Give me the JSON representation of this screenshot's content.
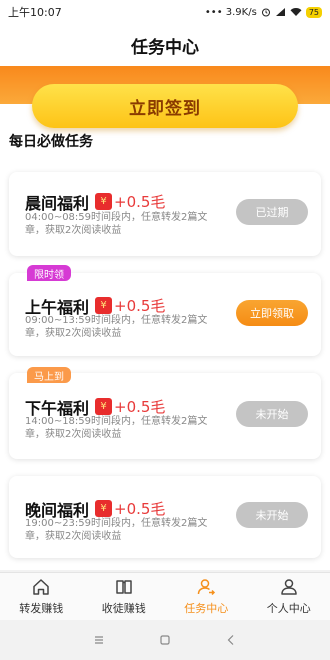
{
  "status": {
    "time": "上午10:07",
    "network": "••• 3.9K/s",
    "battery": "75"
  },
  "title": "任务中心",
  "signin": {
    "label": "立即签到"
  },
  "section_title": "每日必做任务",
  "tasks": [
    {
      "name": "晨间福利",
      "yen": "¥",
      "reward": "+0.5毛",
      "desc": "04:00~08:59时间段内，任意转发2篇文章，获取2次阅读收益",
      "button": "已过期",
      "tag": ""
    },
    {
      "name": "上午福利",
      "yen": "¥",
      "reward": "+0.5毛",
      "desc": "09:00~13:59时间段内，任意转发2篇文章，获取2次阅读收益",
      "button": "立即领取",
      "tag": "限时领"
    },
    {
      "name": "下午福利",
      "yen": "¥",
      "reward": "+0.5毛",
      "desc": "14:00~18:59时间段内，任意转发2篇文章，获取2次阅读收益",
      "button": "未开始",
      "tag": "马上到"
    },
    {
      "name": "晚间福利",
      "yen": "¥",
      "reward": "+0.5毛",
      "desc": "19:00~23:59时间段内，任意转发2篇文章，获取2次阅读收益",
      "button": "未开始",
      "tag": ""
    }
  ],
  "nav": [
    {
      "label": "转发赚钱",
      "icon": "home-icon"
    },
    {
      "label": "收徒赚钱",
      "icon": "book-icon"
    },
    {
      "label": "任务中心",
      "icon": "person-add-icon",
      "active": true
    },
    {
      "label": "个人中心",
      "icon": "person-icon"
    }
  ],
  "colors": {
    "accent": "#f5901c",
    "reward": "#e83a3a",
    "signin": "#fdc316"
  }
}
